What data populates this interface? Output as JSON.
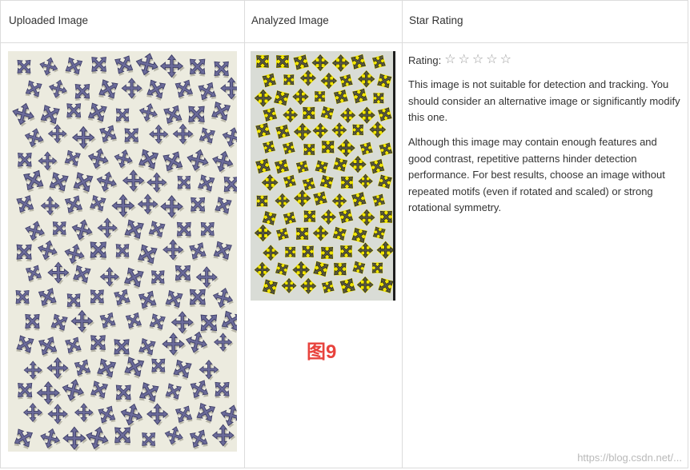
{
  "table": {
    "headers": {
      "uploaded": "Uploaded Image",
      "analyzed": "Analyzed Image",
      "rating": "Star Rating"
    }
  },
  "rating": {
    "label": "Rating:",
    "stars_filled": 0,
    "stars_total": 5,
    "star_glyph": "☆"
  },
  "messages": {
    "p1": "This image is not suitable for detection and tracking. You should consider an alternative image or significantly modify this one.",
    "p2": "Although this image may contain enough features and good contrast, repetitive patterns hinder detection performance. For best results, choose an image without repeated motifs (even if rotated and scaled) or strong rotational symmetry."
  },
  "figure_label": "图9",
  "watermark": "https://blog.csdn.net/...",
  "colors": {
    "border": "#dcdcdc",
    "uploaded_bg": "#ecebdf",
    "analyzed_bg": "#d9dcd6",
    "feature_yellow": "#f2e600",
    "motif_blue": "#6b6b9a",
    "label_red": "#e8433d"
  },
  "icons": {
    "motif": "arrow-cross-icon",
    "star": "star-outline-icon"
  }
}
